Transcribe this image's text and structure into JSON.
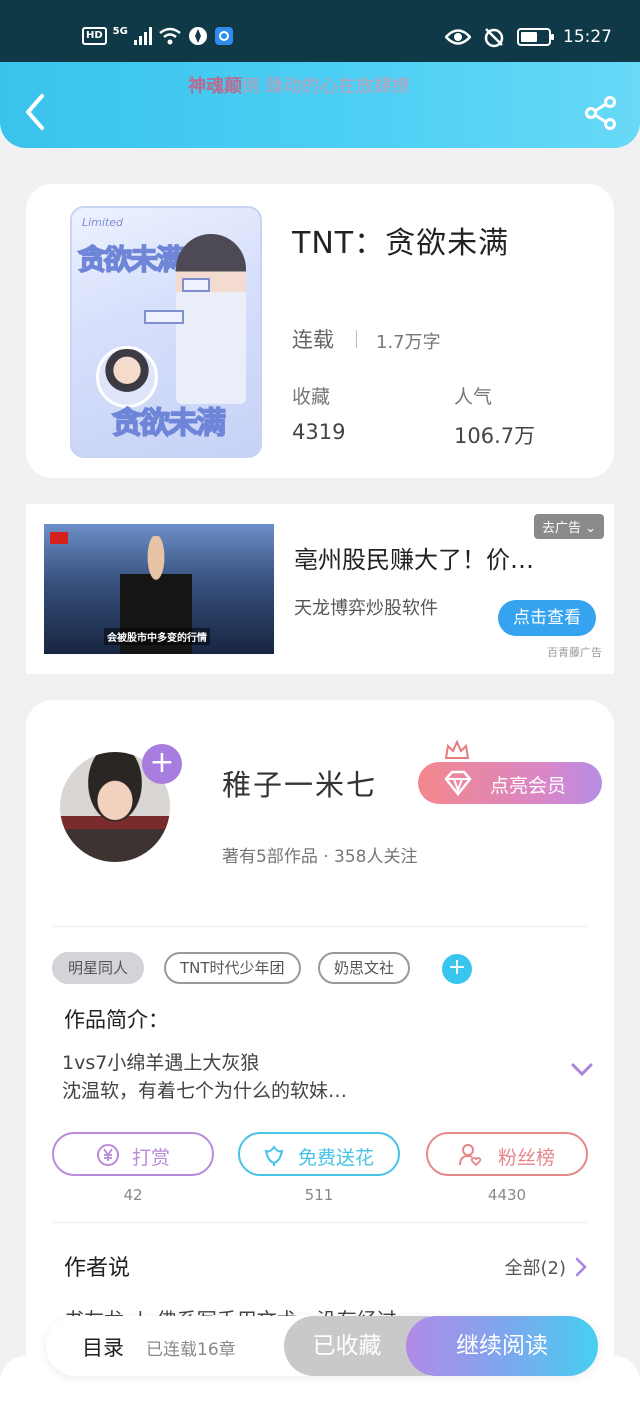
{
  "status_bar": {
    "hd": "HD",
    "network": "5G",
    "time": "15:27"
  },
  "header": {
    "marquee_highlight": "神魂颠",
    "marquee_rest": "倒 躁动的心在放肆撩",
    "back_icon": "chevron-left-icon",
    "share_icon": "share-icon"
  },
  "book": {
    "title": "TNT：贪欲未满",
    "status": "连载",
    "words": "1.7万字",
    "collect_label": "收藏",
    "collect_value": "4319",
    "popularity_label": "人气",
    "popularity_value": "106.7万",
    "cover": {
      "line1": "Limited",
      "title_top": "贪欲未满",
      "title_bottom": "贪欲未满"
    }
  },
  "ad": {
    "close_label": "去广告",
    "title": "亳州股民赚大了！价…",
    "desc": "天龙博弈炒股软件",
    "button": "点击查看",
    "source": "百青藤广告",
    "caption": "会被股市中多变的行情"
  },
  "author": {
    "name": "稚子一米七",
    "vip_label": "点亮会员",
    "meta": "著有5部作品 · 358人关注",
    "tags": [
      "明星同人",
      "TNT时代少年团",
      "奶思文社"
    ],
    "intro_heading": "作品简介：",
    "intro_line1": "1vs7小绵羊遇上大灰狼",
    "intro_line2": "沈温软，有着七个为什么的软妹…",
    "actions": [
      {
        "label": "打赏",
        "count": "42",
        "color": "#b98ad9"
      },
      {
        "label": "免费送花",
        "count": "511",
        "color": "#46c3e6"
      },
      {
        "label": "粉丝榜",
        "count": "4430",
        "color": "#e5868a"
      }
    ],
    "says_heading": "作者说",
    "says_all": "全部(2)",
    "says_text": "书友龙 〡 佛系写手用文术，没有经过"
  },
  "bottom_bar": {
    "toc": "目录",
    "toc_sub": "已连载16章",
    "fav": "已收藏",
    "read": "继续阅读"
  }
}
